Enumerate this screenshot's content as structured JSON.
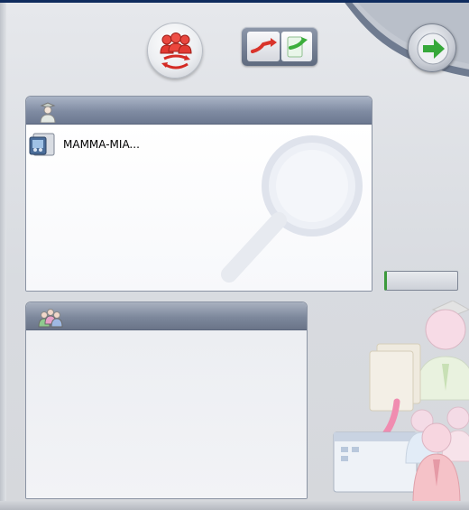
{
  "toolbar": {
    "group_button_icon": "user-group-sync-icon",
    "swap_button_icon": "transfer-arrows-icon",
    "go_button_icon": "green-arrow-right-icon"
  },
  "items_panel": {
    "header_icon": "single-user-icon",
    "items": [
      {
        "label": "MAMMA-MIA...",
        "icon": "movie-file-icon"
      }
    ]
  },
  "groups_panel": {
    "header_icon": "user-group-icon",
    "items": []
  },
  "status_field": {
    "value": ""
  },
  "colors": {
    "title_bar": "#0f2c5e",
    "panel_header": "#7f8ba2",
    "accent_green": "#3cae3c",
    "accent_red": "#d9342b"
  }
}
